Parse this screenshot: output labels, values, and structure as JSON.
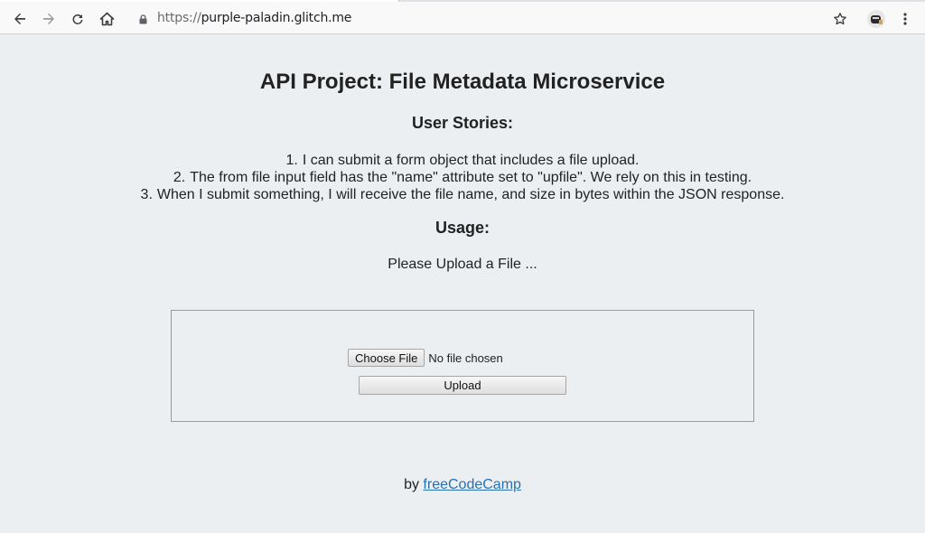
{
  "browser": {
    "url_scheme": "https://",
    "url_host": "purple-paladin.glitch.me",
    "icons": [
      "back-icon",
      "forward-icon",
      "reload-icon",
      "home-icon",
      "lock-icon",
      "star-icon",
      "avatar",
      "menu-icon"
    ]
  },
  "page": {
    "title": "API Project: File Metadata Microservice",
    "stories_heading": "User Stories:",
    "stories": [
      {
        "num": "1.",
        "text": "I can submit a form object that includes a file upload."
      },
      {
        "num": "2.",
        "text": "The from file input field has the \"name\" attribute set to \"upfile\". We rely on this in testing."
      },
      {
        "num": "3.",
        "text": "When I submit something, I will receive the file name, and size in bytes within the JSON response."
      }
    ],
    "usage_heading": "Usage:",
    "usage_text": "Please Upload a File ...",
    "form": {
      "choose_label": "Choose File",
      "no_file_text": "No file chosen",
      "upload_label": "Upload"
    },
    "footer": {
      "by_text": "by ",
      "link_text": "freeCodeCamp"
    }
  }
}
